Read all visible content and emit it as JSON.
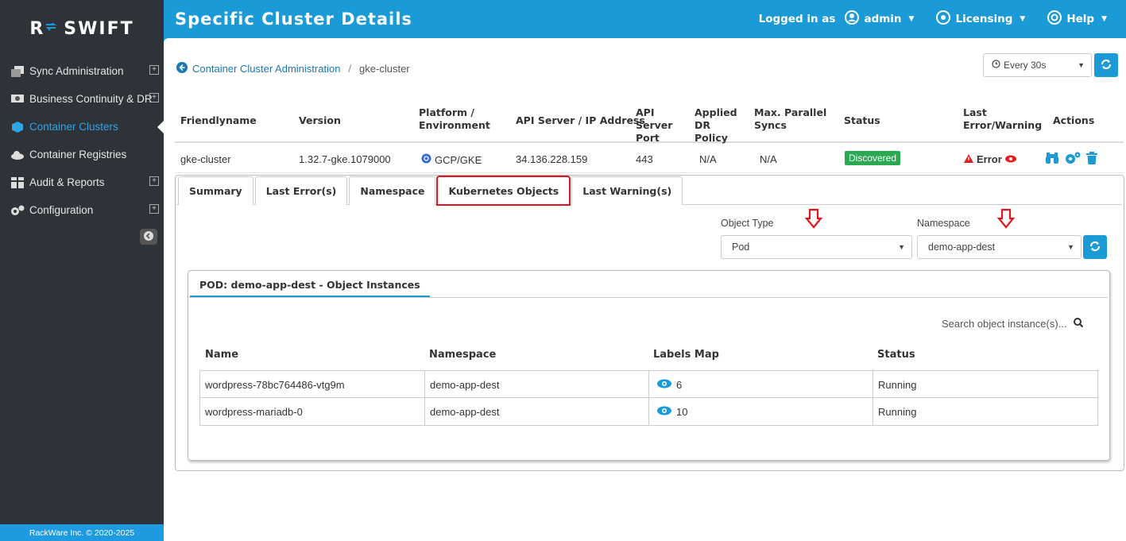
{
  "brand": {
    "name": "SWIFT",
    "logo_text": "R"
  },
  "sidebar": {
    "items": [
      {
        "label": "Sync Administration",
        "icon": "copy-icon",
        "expandable": true
      },
      {
        "label": "Business Continuity & DR",
        "icon": "presentation-icon",
        "expandable": true
      },
      {
        "label": "Container Clusters",
        "icon": "cube-icon",
        "expandable": false,
        "active": true
      },
      {
        "label": "Container Registries",
        "icon": "cloud-icon",
        "expandable": false
      },
      {
        "label": "Audit & Reports",
        "icon": "table-icon",
        "expandable": true
      },
      {
        "label": "Configuration",
        "icon": "gears-icon",
        "expandable": true
      }
    ],
    "footer": "RackWare Inc. © 2020-2025"
  },
  "header": {
    "title": "Specific Cluster Details",
    "logged_in_label": "Logged in as",
    "user": "admin",
    "licensing": "Licensing",
    "help": "Help"
  },
  "breadcrumb": {
    "parent": "Container Cluster Administration",
    "separator": "/",
    "current": "gke-cluster"
  },
  "refresh": {
    "selected": "Every 30s"
  },
  "cluster_table": {
    "columns": [
      "Friendlyname",
      "Version",
      "Platform / Environment",
      "API Server / IP Address",
      "API Server Port",
      "Applied DR Policy",
      "Max. Parallel Syncs",
      "Status",
      "Last Error/Warning",
      "Actions"
    ],
    "row": {
      "friendlyname": "gke-cluster",
      "version": "1.32.7-gke.1079000",
      "platform": "GCP/GKE",
      "api_server": "34.136.228.159",
      "port": "443",
      "dr_policy": "N/A",
      "parallel_syncs": "N/A",
      "status": "Discovered",
      "last_error": "Error"
    }
  },
  "tabs": [
    "Summary",
    "Last Error(s)",
    "Namespace",
    "Kubernetes Objects",
    "Last Warning(s)"
  ],
  "filters": {
    "object_type_label": "Object Type",
    "object_type_value": "Pod",
    "namespace_label": "Namespace",
    "namespace_value": "demo-app-dest"
  },
  "instances": {
    "tab_label": "POD: demo-app-dest - Object Instances",
    "search_placeholder": "Search object instance(s)...",
    "columns": [
      "Name",
      "Namespace",
      "Labels Map",
      "Status"
    ],
    "rows": [
      {
        "name": "wordpress-78bc764486-vtg9m",
        "namespace": "demo-app-dest",
        "labels": "6",
        "status": "Running"
      },
      {
        "name": "wordpress-mariadb-0",
        "namespace": "demo-app-dest",
        "labels": "10",
        "status": "Running"
      }
    ]
  },
  "colors": {
    "primary": "#1a9ad6",
    "sidebar": "#2d3338",
    "success": "#2aa952",
    "danger": "#e0141e"
  }
}
